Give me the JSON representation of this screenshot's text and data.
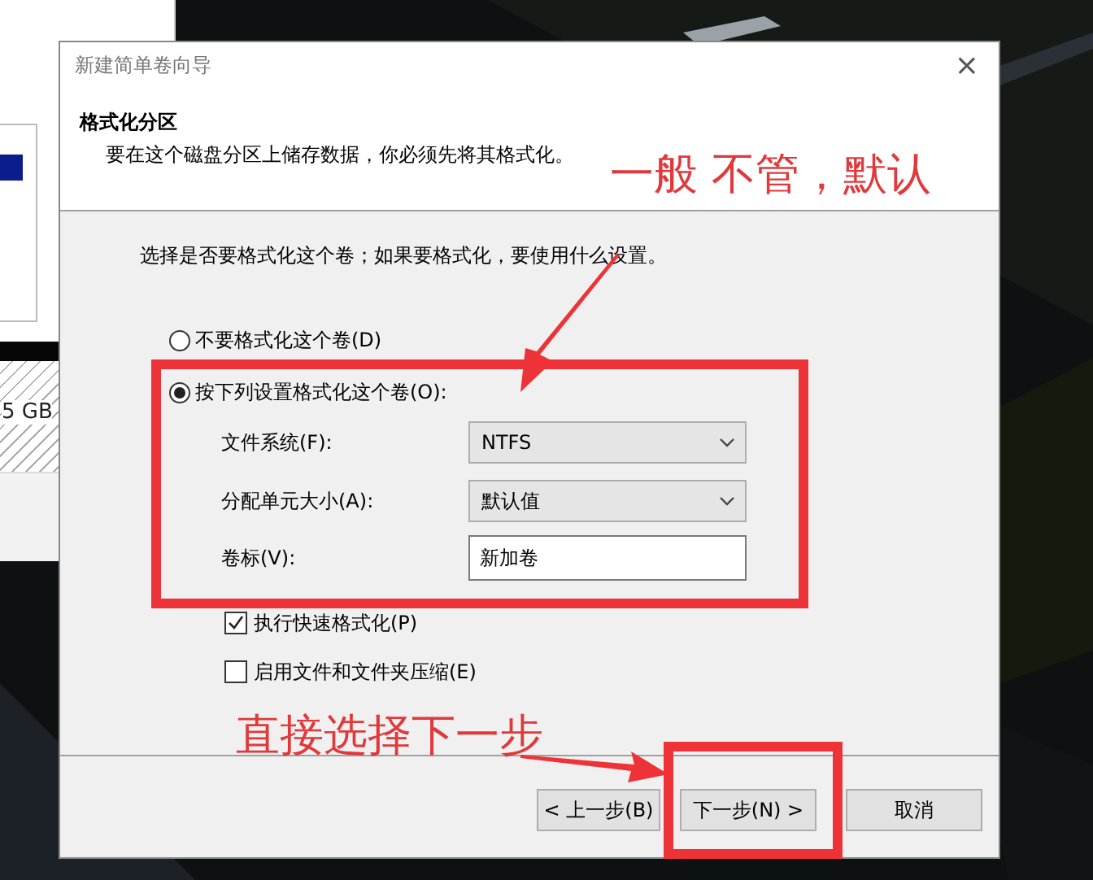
{
  "background_window": {
    "size_label": "5 GB"
  },
  "dialog": {
    "title": "新建简单卷向导",
    "close": "×",
    "header": {
      "title": "格式化分区",
      "subtitle": "要在这个磁盘分区上储存数据，你必须先将其格式化。"
    },
    "prompt": "选择是否要格式化这个卷；如果要格式化，要使用什么设置。",
    "options": [
      {
        "label": "不要格式化这个卷(D)",
        "selected": false
      },
      {
        "label": "按下列设置格式化这个卷(O):",
        "selected": true
      }
    ],
    "fields": [
      {
        "kind": "select",
        "label": "文件系统(F):",
        "value": "NTFS"
      },
      {
        "kind": "select",
        "label": "分配单元大小(A):",
        "value": "默认值"
      },
      {
        "kind": "text",
        "label": "卷标(V):",
        "value": "新加卷"
      }
    ],
    "checkboxes": [
      {
        "label": "执行快速格式化(P)",
        "checked": true
      },
      {
        "label": "启用文件和文件夹压缩(E)",
        "checked": false
      }
    ],
    "buttons": [
      {
        "label": "< 上一步(B)"
      },
      {
        "label": "下一步(N) >"
      },
      {
        "label": "取消"
      }
    ]
  },
  "annotations": [
    {
      "kind": "note",
      "text": "一般 不管，默认"
    },
    {
      "kind": "note",
      "text": "直接选择下一步"
    },
    {
      "kind": "frame"
    },
    {
      "kind": "frame"
    },
    {
      "kind": "arrow"
    },
    {
      "kind": "arrow"
    }
  ]
}
